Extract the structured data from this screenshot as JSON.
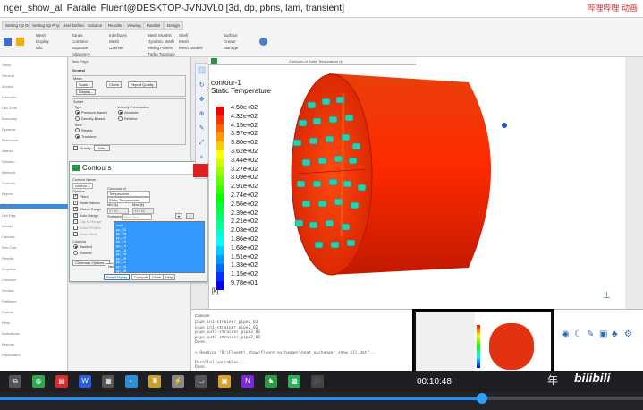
{
  "window": {
    "title": "nger_show_all Parallel Fluent@DESKTOP-JVNJVL0 [3d, dp, pbns, lam, transient]",
    "watermark": "哔哩哔哩 动画"
  },
  "ribbon": {
    "tabs": [
      "Setting Up Domain",
      "Setting Up Physics",
      "User Defined",
      "Solution",
      "Results",
      "Viewing",
      "Parallel",
      "Design"
    ],
    "groups": [
      {
        "name": "Mesh",
        "items": [
          "Display",
          "Info",
          "Check",
          "Quality"
        ]
      },
      {
        "name": "Zones",
        "items": [
          "Combine",
          "Separate",
          "Adjacency",
          "Append"
        ]
      },
      {
        "name": "Interfaces",
        "items": [
          "Mesh",
          "Overset"
        ]
      },
      {
        "name": "Mesh Models",
        "items": [
          "Dynamic Mesh",
          "Mixing Planes",
          "Turbo Topology"
        ]
      },
      {
        "name": "Shell",
        "items": [
          "Mesh",
          "Mesh Models"
        ]
      },
      {
        "name": "Surface",
        "items": [
          "Create",
          "Manage"
        ]
      }
    ]
  },
  "tree": {
    "items": [
      "Setup",
      "General",
      "Models",
      "Materials",
      "Cell Zone",
      "Boundary",
      "Dynamic",
      "Reference",
      "Named",
      "Solution",
      "Methods",
      "Controls",
      "Report",
      "Monitors",
      "Cell Reg",
      "Initializ",
      "Calculat",
      "Run Calc",
      "Results",
      "Graphics",
      "Contours",
      "Vectors",
      "Pathlines",
      "Particle",
      "Plots",
      "Animations",
      "Reports",
      "Parameters"
    ]
  },
  "taskpage": {
    "title": "Task Page",
    "mesh_label": "Mesh",
    "buttons": [
      "Scale...",
      "Check",
      "Report Quality",
      "Display..."
    ],
    "solver_label": "Solver",
    "type_label": "Type",
    "type_options": [
      "Pressure-Based",
      "Density-Based"
    ],
    "velocity_label": "Velocity Formulation",
    "velocity_options": [
      "Absolute",
      "Relative"
    ],
    "time_label": "Time",
    "time_options": [
      "Steady",
      "Transient"
    ],
    "gravity_label": "Gravity",
    "units_button": "Units..."
  },
  "contours_dialog": {
    "title": "Contours",
    "contour_name_label": "Contour Name",
    "contour_name_value": "contour-1",
    "options_label": "Options",
    "options": [
      {
        "label": "Filled",
        "checked": true
      },
      {
        "label": "Node Values",
        "checked": true
      },
      {
        "label": "Global Range",
        "checked": true
      },
      {
        "label": "Auto Range",
        "checked": true
      },
      {
        "label": "Clip to Range",
        "checked": false
      },
      {
        "label": "Draw Profiles",
        "checked": false
      },
      {
        "label": "Draw Mesh",
        "checked": false
      }
    ],
    "contours_of_label": "Contours of",
    "contours_of_value": "Temperature...",
    "contours_of_sub": "Static Temperature",
    "min_label": "Min [k]",
    "max_label": "Max [k]",
    "min_value": "97.81",
    "max_value": "449.86",
    "surfaces_label": "Surfaces",
    "surfaces_filter": "Filter Text",
    "surfaces": [
      "wall",
      "pp_02",
      "pp_04",
      "pp_10",
      "pp_12",
      "pp_14",
      "pp_16",
      "pp_18",
      "pp_20",
      "pp_22",
      "pp_24",
      "pp_26"
    ],
    "coloring_label": "Coloring",
    "coloring_options": [
      "Banded",
      "Smooth"
    ],
    "colormap_button": "Colormap Options...",
    "new_surface": "New Surface",
    "actions": [
      "Save/Display",
      "Compute",
      "Close",
      "Help"
    ]
  },
  "graphics": {
    "tab_label": "Contours of Static Temperature (k)",
    "legend_title_1": "contour-1",
    "legend_title_2": "Static Temperature",
    "legend_values": [
      "4.50e+02",
      "4.32e+02",
      "4.15e+02",
      "3.97e+02",
      "3.80e+02",
      "3.62e+02",
      "3.44e+02",
      "3.27e+02",
      "3.09e+02",
      "2.91e+02",
      "2.74e+02",
      "2.56e+02",
      "2.39e+02",
      "2.21e+02",
      "2.03e+02",
      "1.86e+02",
      "1.68e+02",
      "1.51e+02",
      "1.33e+02",
      "1.15e+02",
      "9.78e+01"
    ],
    "legend_unit": "[k]",
    "legend_colors": [
      "#ff0000",
      "#ff3300",
      "#ff6600",
      "#ff9900",
      "#ffcc00",
      "#ffff00",
      "#ccff00",
      "#99ff00",
      "#66ff00",
      "#33ff00",
      "#00ff00",
      "#00ff33",
      "#00ff66",
      "#00ff99",
      "#00ffcc",
      "#00ffff",
      "#00ccff",
      "#0099ff",
      "#0066ff",
      "#0033ff",
      "#0000ff"
    ]
  },
  "console": {
    "label": "Console",
    "lines": [
      "pipe_in1-strainer_pipe2_01",
      "pipe_in1-strainer_pipe2_02",
      "pipe_out1-strainer_pipe2_01",
      "pipe_out1-strainer_pipe2_02",
      "Done.",
      "",
      "> Reading \"D:\\Fluent\\_show\\fluent_exchanger\\heat_exchanger_show_all.dat\"...",
      "",
      "Parallel variables...",
      "Done."
    ]
  },
  "video": {
    "timecode": "00:10:48",
    "progress": 0.75,
    "colors": {
      "accent": "#1e90ff"
    }
  },
  "taskbar": {
    "icons": [
      "task-view-icon",
      "chrome-icon",
      "acrobat-icon",
      "word-icon",
      "files-icon",
      "edge-icon",
      "ansys-icon",
      "vscode-icon",
      "media-icon",
      "notes-icon",
      "onenote-icon",
      "app-icon",
      "fluent-icon",
      "screen-recorder-icon"
    ]
  }
}
